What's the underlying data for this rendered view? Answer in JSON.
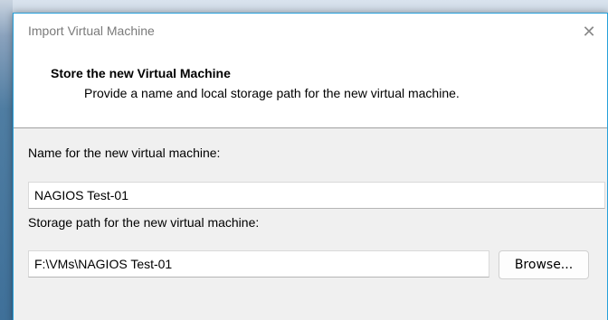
{
  "window": {
    "title": "Import Virtual Machine",
    "close_glyph": "✕"
  },
  "header": {
    "title": "Store the new Virtual Machine",
    "subtitle": "Provide a name and local storage path for the new virtual machine."
  },
  "form": {
    "name_label": "Name for the new virtual machine:",
    "name_value": "NAGIOS Test-01",
    "path_label": "Storage path for the new virtual machine:",
    "path_value": "F:\\VMs\\NAGIOS Test-01",
    "browse_label": "Browse..."
  },
  "colors": {
    "accent_border": "#26a0da",
    "dialog_bg": "#f0f0f0",
    "header_bg": "#ffffff"
  }
}
